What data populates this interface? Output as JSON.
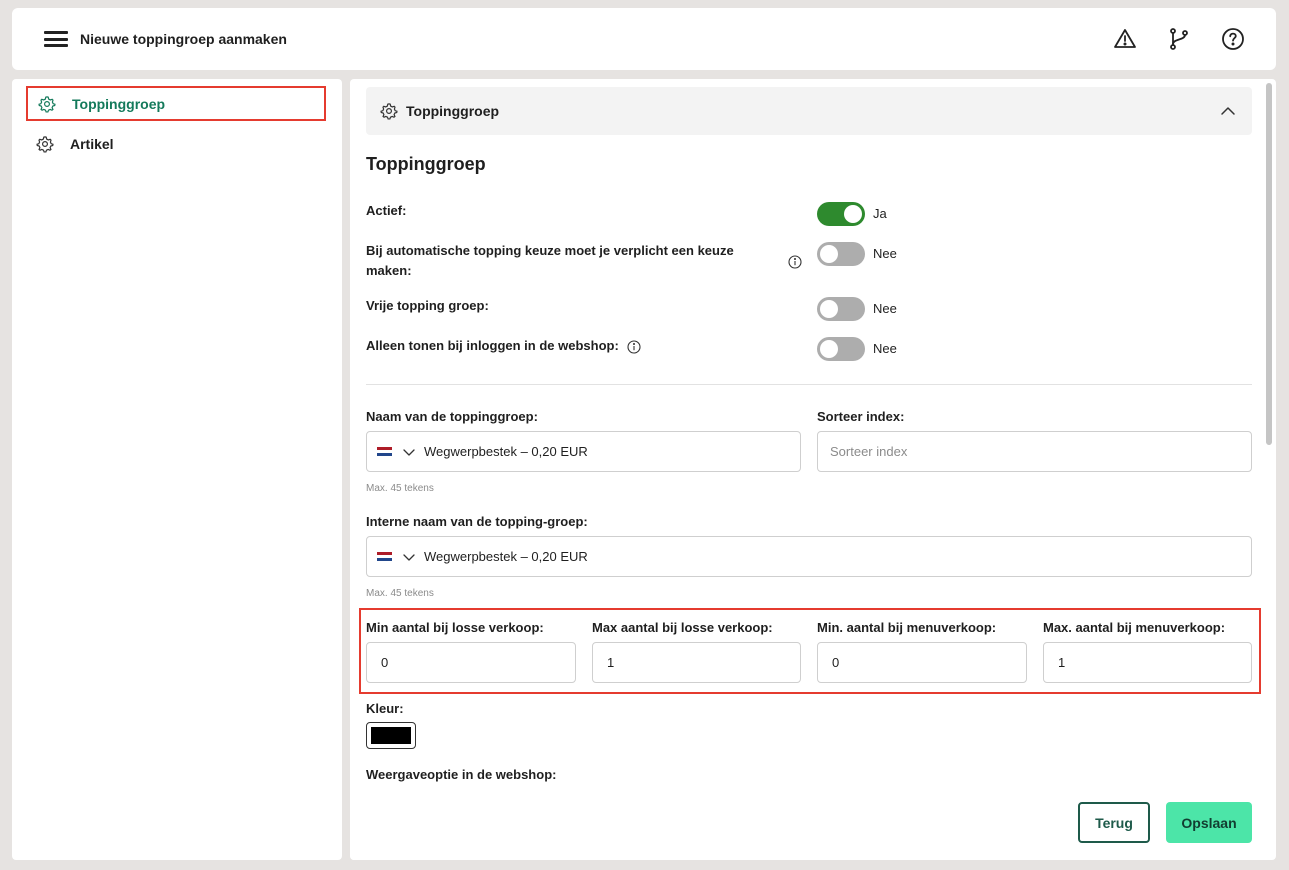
{
  "header": {
    "title": "Nieuwe toppingroep aanmaken",
    "icons": [
      "warning-icon",
      "branch-icon",
      "help-icon"
    ]
  },
  "sidebar": {
    "items": [
      {
        "label": "Toppinggroep",
        "icon": "gear-icon",
        "active": true
      },
      {
        "label": "Artikel",
        "icon": "gear-icon",
        "active": false
      }
    ]
  },
  "section": {
    "header_label": "Toppinggroep",
    "title": "Toppinggroep"
  },
  "toggles": [
    {
      "label": "Actief:",
      "state": "Ja",
      "on": true
    },
    {
      "label": "Bij automatische topping keuze moet je verplicht een keuze maken:",
      "state": "Nee",
      "on": false
    },
    {
      "label": "Vrije topping groep:",
      "state": "Nee",
      "on": false
    },
    {
      "label": "Alleen tonen bij inloggen in de webshop:",
      "state": "Nee",
      "on": false
    }
  ],
  "fields": {
    "name": {
      "label": "Naam van de toppinggroep:",
      "value": "Wegwerpbestek – 0,20 EUR",
      "hint": "Max. 45 tekens"
    },
    "sort": {
      "label": "Sorteer index:",
      "placeholder": "Sorteer index"
    },
    "internal_name": {
      "label": "Interne naam van de topping-groep:",
      "value": "Wegwerpbestek – 0,20 EUR",
      "hint": "Max. 45 tekens"
    },
    "min_single": {
      "label": "Min aantal bij losse verkoop:",
      "value": "0"
    },
    "max_single": {
      "label": "Max aantal bij losse verkoop:",
      "value": "1"
    },
    "min_menu": {
      "label": "Min. aantal bij menuverkoop:",
      "value": "0"
    },
    "max_menu": {
      "label": "Max. aantal bij menuverkoop:",
      "value": "1"
    },
    "color": {
      "label": "Kleur:",
      "value": "#000000"
    },
    "display": {
      "label": "Weergaveoptie in de webshop:"
    }
  },
  "buttons": {
    "back": "Terug",
    "save": "Opslaan"
  },
  "colors": {
    "accent_green": "#147a5b",
    "toggle_on": "#2e8a2e",
    "save_button": "#4ce5a8",
    "highlight_red": "#e53b2f",
    "flag_red": "#ae1c28",
    "flag_white": "#ffffff",
    "flag_blue": "#21468b"
  }
}
